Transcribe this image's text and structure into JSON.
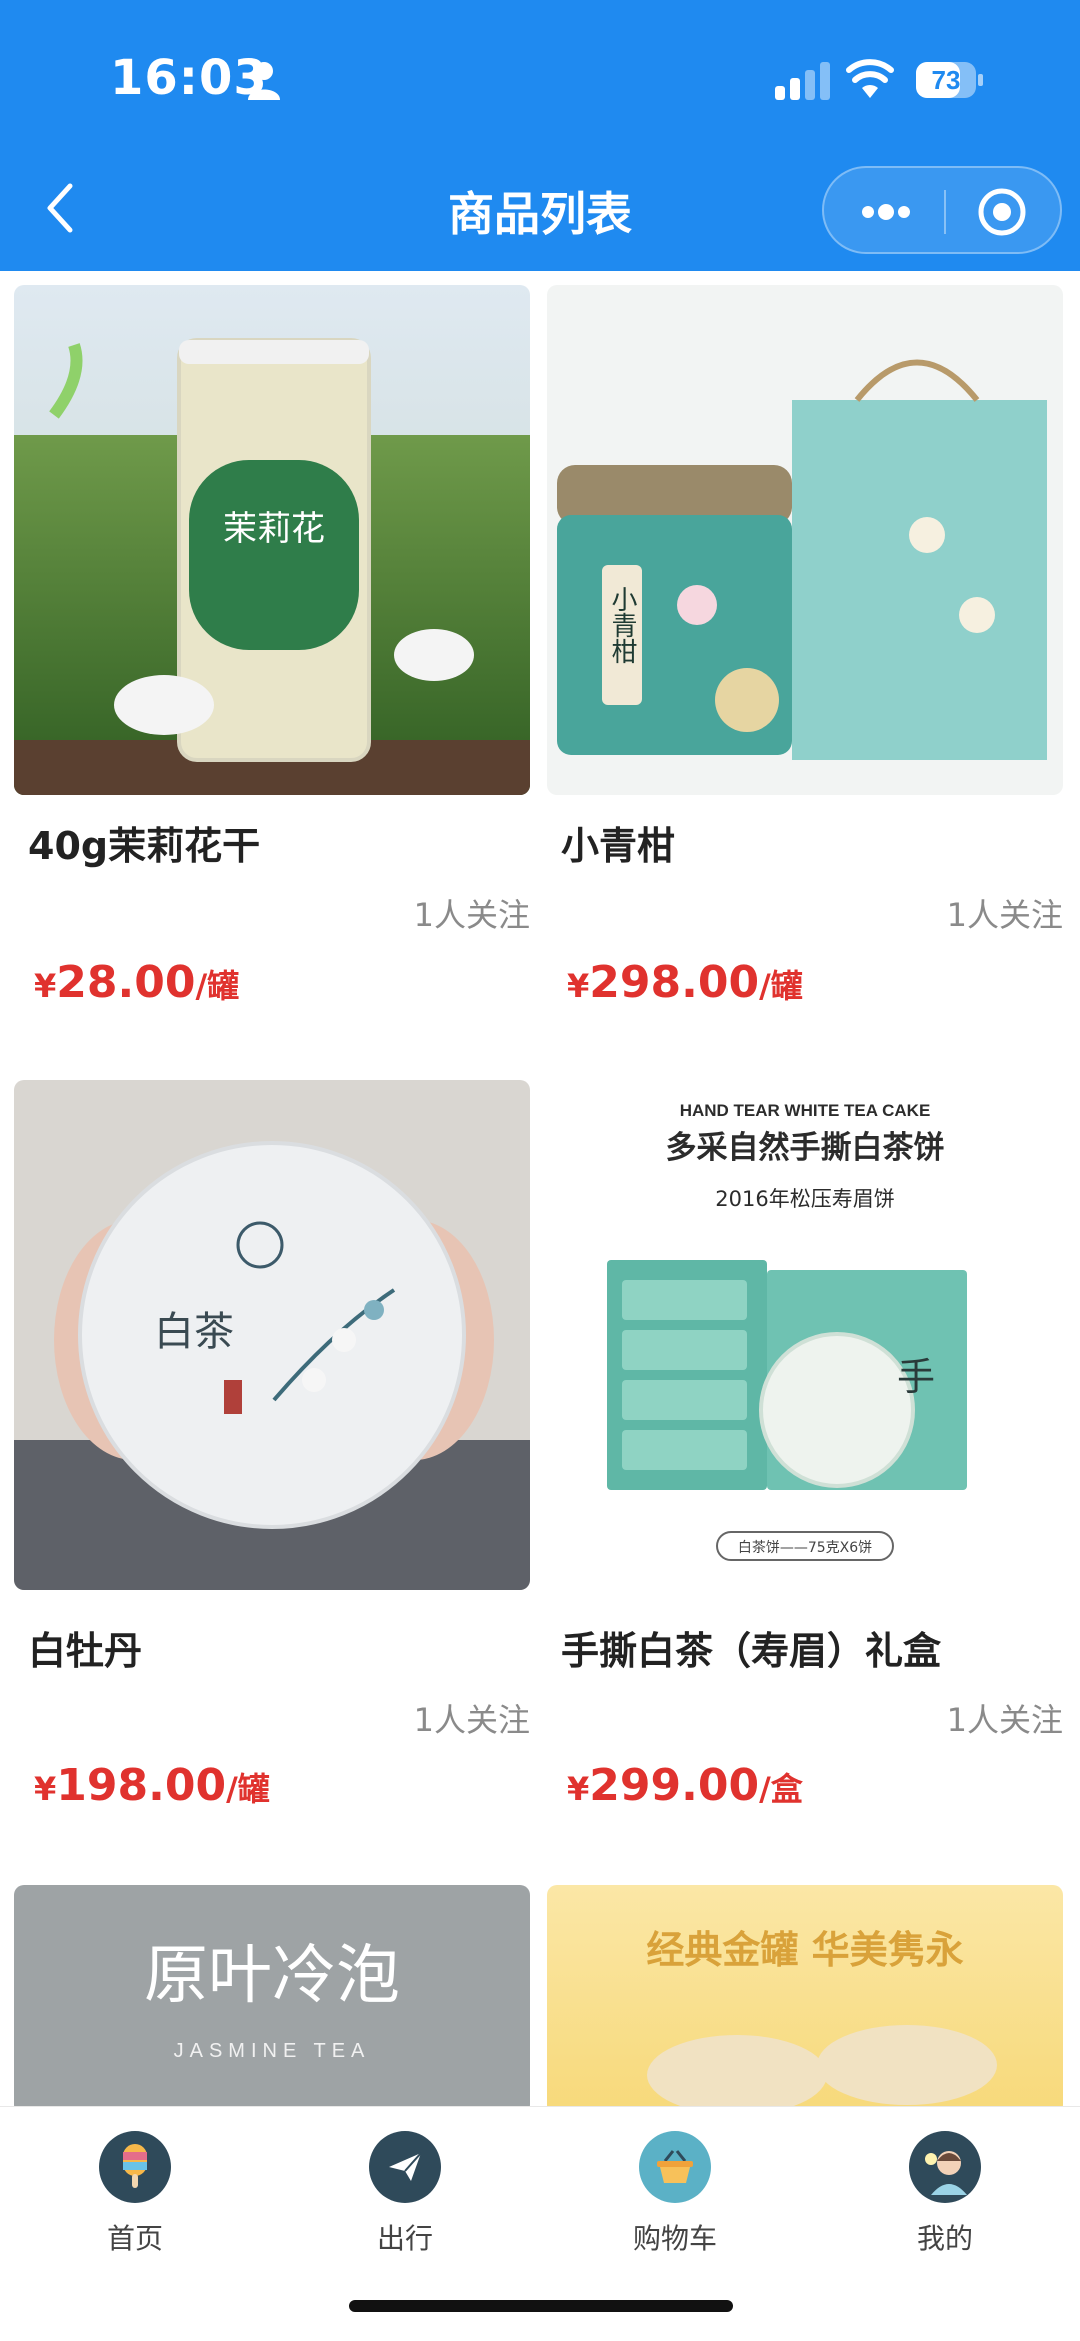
{
  "status_bar": {
    "time": "16:03",
    "battery": "73"
  },
  "nav": {
    "title": "商品列表"
  },
  "products": [
    {
      "name": "40g茉莉花干",
      "follow": "1人关注",
      "currency": "¥",
      "price": "28.00",
      "unit": "/罐",
      "image_text": "茉莉花"
    },
    {
      "name": "小青柑",
      "follow": "1人关注",
      "currency": "¥",
      "price": "298.00",
      "unit": "/罐",
      "image_text": "小青柑"
    },
    {
      "name": "白牡丹",
      "follow": "1人关注",
      "currency": "¥",
      "price": "198.00",
      "unit": "/罐",
      "image_text": "白茶"
    },
    {
      "name": "手撕白茶（寿眉）礼盒",
      "follow": "1人关注",
      "currency": "¥",
      "price": "299.00",
      "unit": "/盒",
      "image_title_en": "HAND TEAR WHITE TEA CAKE",
      "image_title": "多采自然手撕白茶饼",
      "image_subtitle": "2016年松压寿眉饼",
      "image_note": "白茶饼——75克X6饼"
    },
    {
      "image_title": "原叶冷泡",
      "image_subtitle": "JASMINE TEA"
    },
    {
      "image_title": "经典金罐 华美隽永"
    }
  ],
  "tabbar": {
    "items": [
      {
        "label": "首页",
        "icon": "popsicle-icon"
      },
      {
        "label": "出行",
        "icon": "paper-plane-icon"
      },
      {
        "label": "购物车",
        "icon": "basket-icon"
      },
      {
        "label": "我的",
        "icon": "avatar-icon"
      }
    ]
  },
  "colors": {
    "brand_blue": "#1f8af0",
    "price_red": "#e0322e",
    "tab_dark": "#2f4a5a"
  }
}
